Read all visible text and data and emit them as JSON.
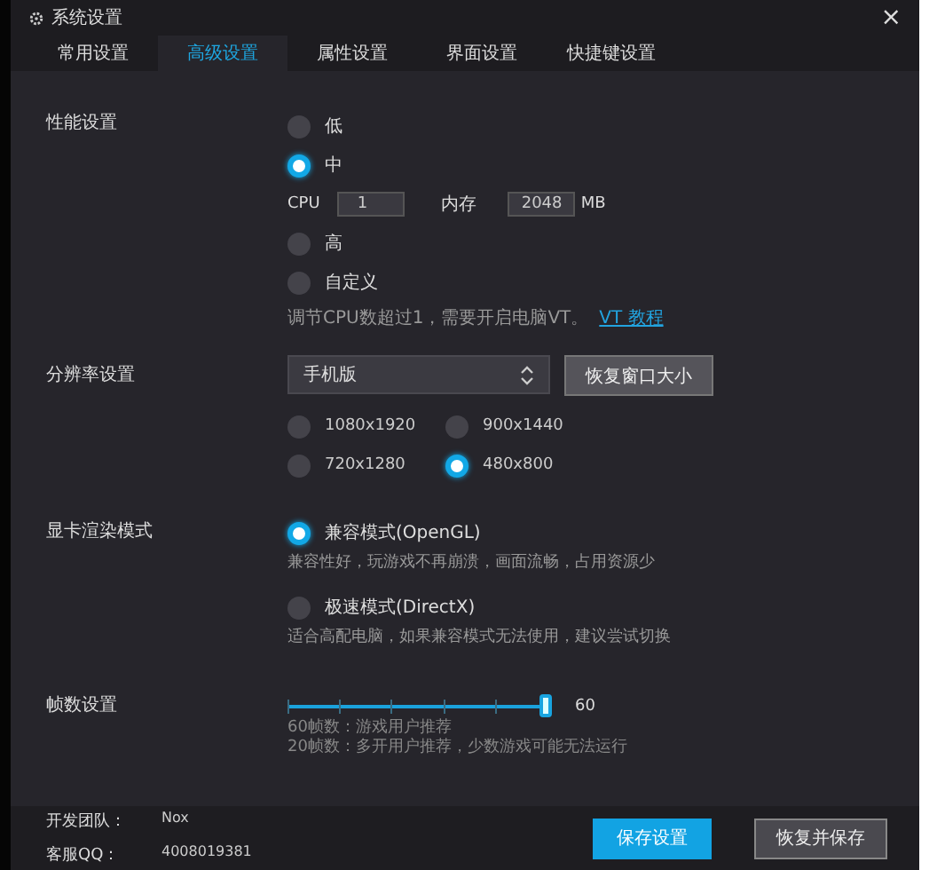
{
  "window": {
    "title": "系统设置",
    "close": "×"
  },
  "tabs": [
    {
      "label": "常用设置",
      "selected": false
    },
    {
      "label": "高级设置",
      "selected": true
    },
    {
      "label": "属性设置",
      "selected": false
    },
    {
      "label": "界面设置",
      "selected": false
    },
    {
      "label": "快捷键设置",
      "selected": false
    }
  ],
  "performance": {
    "label": "性能设置",
    "items": [
      {
        "kind": "radio",
        "label": "低",
        "selected": false
      },
      {
        "kind": "radio",
        "label": "中",
        "selected": true
      },
      {
        "kind": "fields",
        "cpu_label": "CPU",
        "cpu_value": "1",
        "memory_label": "内存",
        "memory_value": "2048",
        "memory_unit": "MB"
      },
      {
        "kind": "radio",
        "label": "高",
        "selected": false
      },
      {
        "kind": "radio",
        "label": "自定义",
        "selected": false
      }
    ],
    "hint": "调节CPU数超过1，需要开启电脑VT。",
    "link": "VT 教程"
  },
  "resolution": {
    "label": "分辨率设置",
    "dropdown": "手机版",
    "button": "恢复窗口大小",
    "options": [
      {
        "label": "1080x1920",
        "selected": false
      },
      {
        "label": "900x1440",
        "selected": false
      },
      {
        "label": "720x1280",
        "selected": false
      },
      {
        "label": "480x800",
        "selected": true
      }
    ]
  },
  "render": {
    "label": "显卡渲染模式",
    "options": [
      {
        "label": "兼容模式(OpenGL)",
        "selected": true,
        "description": "兼容性好，玩游戏不再崩溃，画面流畅，占用资源少"
      },
      {
        "label": "极速模式(DirectX)",
        "selected": false,
        "description": "适合高配电脑，如果兼容模式无法使用，建议尝试切换"
      }
    ]
  },
  "fps": {
    "label": "帧数设置",
    "level": 1,
    "value": "60",
    "notes": [
      "60帧数：游戏用户推荐",
      "20帧数：多开用户推荐，少数游戏可能无法运行"
    ]
  },
  "footer": {
    "team_label": "开发团队：",
    "team": "Nox",
    "qq_label": "客服QQ：",
    "qq": "4008019381",
    "buttons": [
      {
        "label": "保存设置",
        "kind": "primary"
      },
      {
        "label": "恢复并保存",
        "kind": "secondary"
      }
    ]
  }
}
